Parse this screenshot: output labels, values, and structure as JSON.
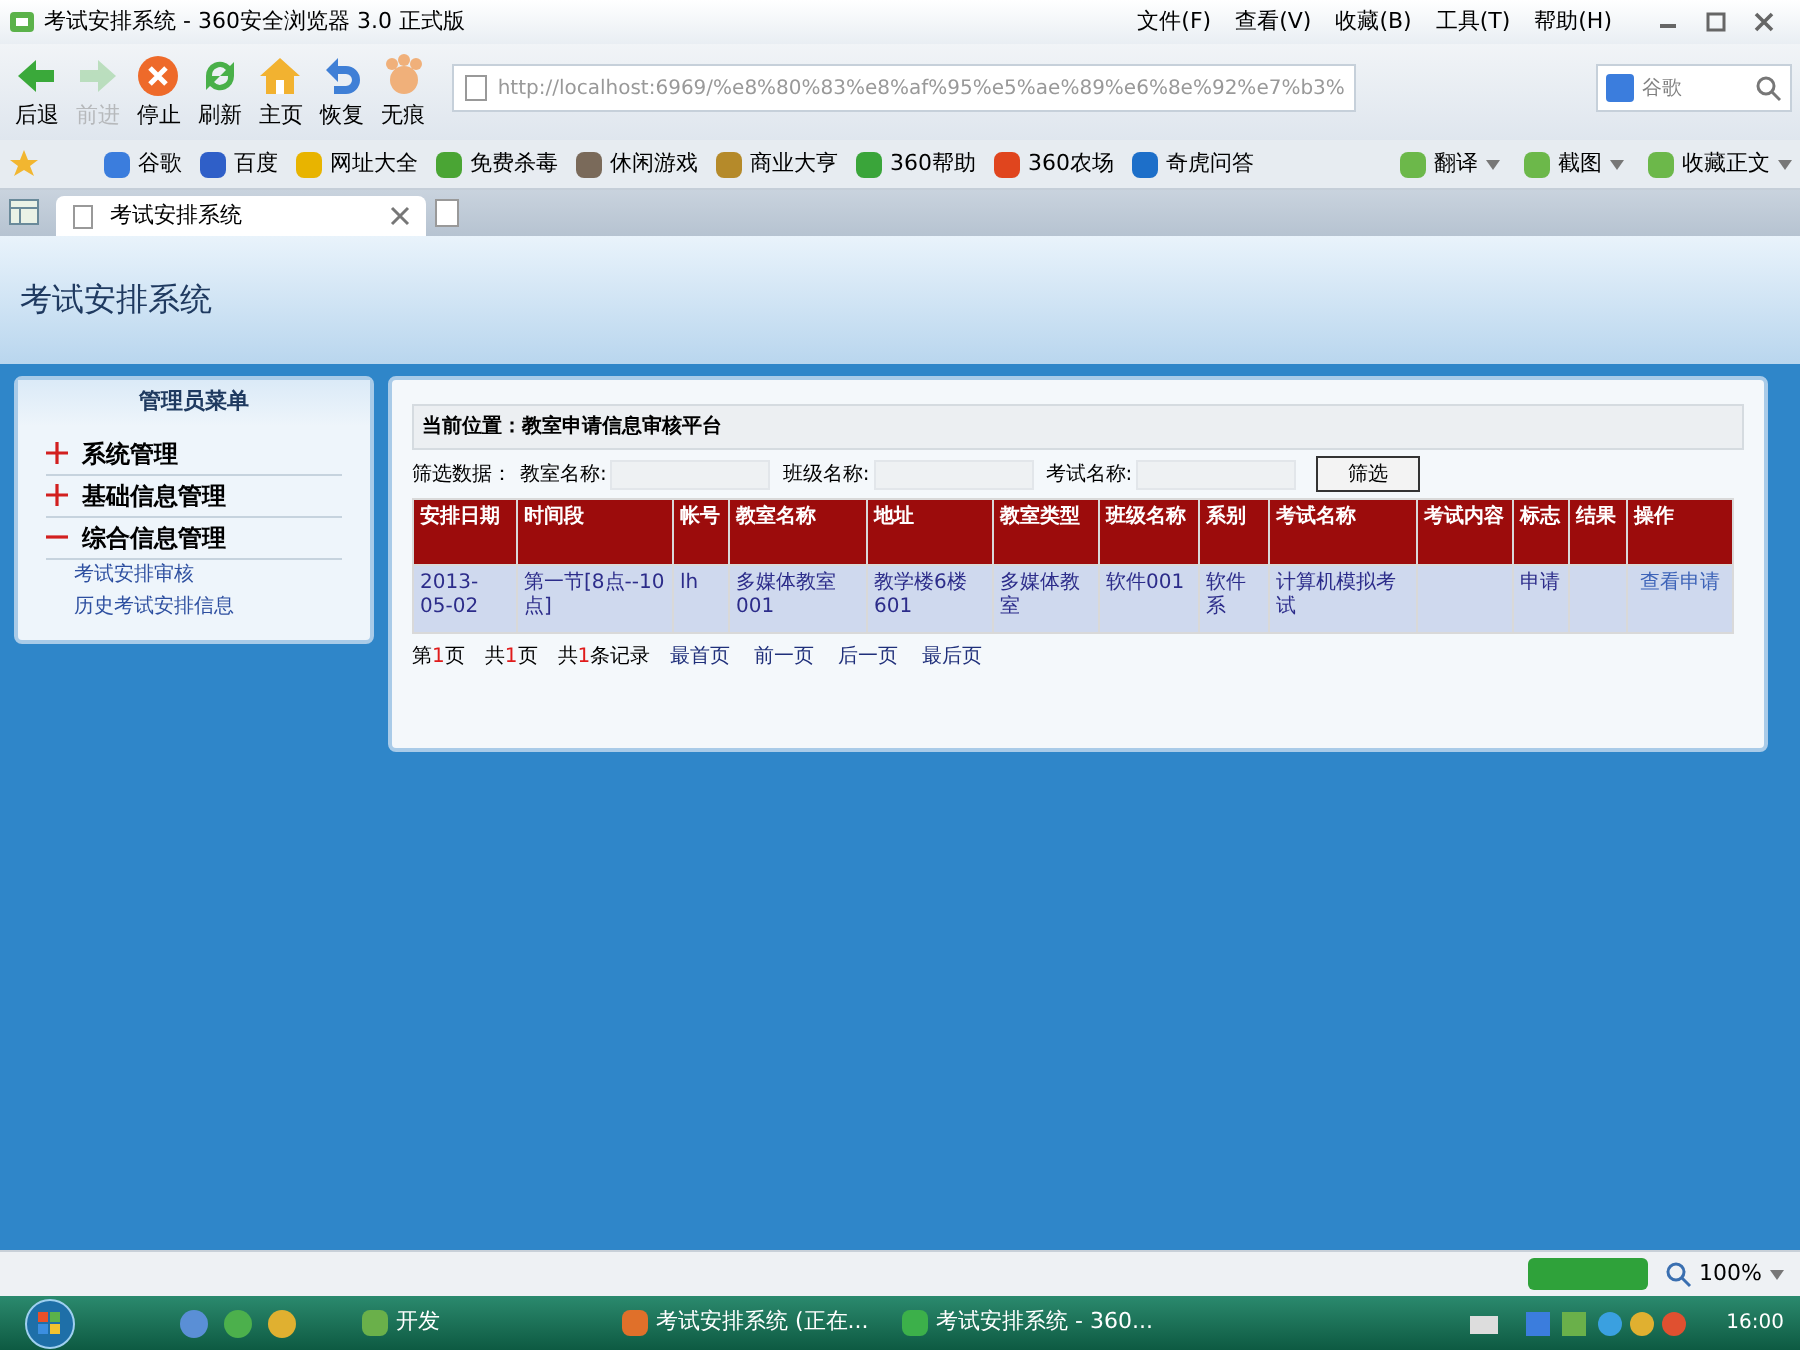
{
  "window": {
    "title": "考试安排系统 - 360安全浏览器 3.0 正式版"
  },
  "menu": [
    "文件(F)",
    "查看(V)",
    "收藏(B)",
    "工具(T)",
    "帮助(H)"
  ],
  "toolbar": [
    {
      "label": "后退",
      "kind": "back",
      "disabled": false
    },
    {
      "label": "前进",
      "kind": "forward",
      "disabled": true
    },
    {
      "label": "停止",
      "kind": "stop",
      "disabled": false
    },
    {
      "label": "刷新",
      "kind": "refresh",
      "disabled": false
    },
    {
      "label": "主页",
      "kind": "home",
      "disabled": false
    },
    {
      "label": "恢复",
      "kind": "undo",
      "disabled": false
    },
    {
      "label": "无痕",
      "kind": "private",
      "disabled": false
    }
  ],
  "address": {
    "value": "http://localhost:6969/%e8%80%83%e8%af%95%e5%ae%89%e6%8e%92%e7%b3%"
  },
  "search": {
    "placeholder": "谷歌"
  },
  "bookmarks": [
    {
      "label": "谷歌",
      "color": "#3b7ddd"
    },
    {
      "label": "百度",
      "color": "#2f5fc8"
    },
    {
      "label": "网址大全",
      "color": "#e8b400"
    },
    {
      "label": "免费杀毒",
      "color": "#4aa534"
    },
    {
      "label": "休闲游戏",
      "color": "#7a6a5a"
    },
    {
      "label": "商业大亨",
      "color": "#b58a2a"
    },
    {
      "label": "360帮助",
      "color": "#3aa53a"
    },
    {
      "label": "360农场",
      "color": "#e0451e"
    },
    {
      "label": "奇虎问答",
      "color": "#1d6fc9"
    }
  ],
  "bookmark_tools": [
    "翻译",
    "截图",
    "收藏正文"
  ],
  "tabs": [
    {
      "label": "考试安排系统",
      "selected": true
    }
  ],
  "page": {
    "header": "考试安排系统",
    "sidebar": {
      "title": "管理员菜单",
      "items": [
        {
          "label": "系统管理",
          "expanded": false
        },
        {
          "label": "基础信息管理",
          "expanded": false
        },
        {
          "label": "综合信息管理",
          "expanded": true,
          "children": [
            {
              "label": "考试安排审核"
            },
            {
              "label": "历史考试安排信息"
            }
          ]
        }
      ]
    },
    "breadcrumb": "当前位置：教室申请信息审核平台",
    "filter": {
      "label": "筛选数据：",
      "fields": [
        {
          "label": "教室名称:"
        },
        {
          "label": "班级名称:"
        },
        {
          "label": "考试名称:"
        }
      ],
      "button": "筛选"
    },
    "table": {
      "columns": [
        "安排日期",
        "时间段",
        "帐号",
        "教室名称",
        "地址",
        "教室类型",
        "班级名称",
        "系别",
        "考试名称",
        "考试内容",
        "标志",
        "结果",
        "操作"
      ],
      "rows": [
        {
          "cells": [
            "2013-05-02",
            "第一节[8点--10点]",
            "lh",
            "多媒体教室001",
            "教学楼6楼601",
            "多媒体教室",
            "软件001",
            "软件系",
            "计算机模拟考试",
            "",
            "申请",
            "",
            "查看申请"
          ]
        }
      ]
    },
    "pagination": {
      "info": [
        {
          "before": "第",
          "num": "1",
          "after": "页"
        },
        {
          "before": "共",
          "num": "1",
          "after": "页"
        },
        {
          "before": "共",
          "num": "1",
          "after": "条记录"
        }
      ],
      "links": [
        "最首页",
        "前一页",
        "后一页",
        "最后页"
      ]
    }
  },
  "status_bar": {
    "zoom": "100%"
  },
  "taskbar": {
    "items": [
      {
        "label": "开发",
        "kind": "folder"
      },
      {
        "label": "考试安排系统 (正在...",
        "kind": "app"
      },
      {
        "label": "考试安排系统 - 360...",
        "kind": "browser"
      }
    ],
    "clock": "16:00"
  }
}
